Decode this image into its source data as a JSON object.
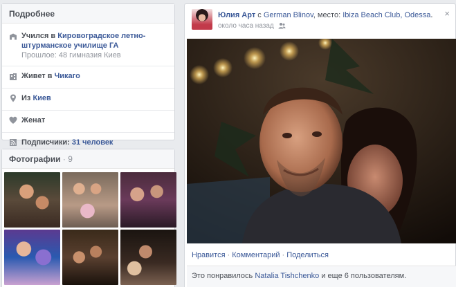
{
  "about": {
    "title": "Подробнее",
    "study": {
      "prefix": "Учился в ",
      "school_line1": "Кировоградское летно-",
      "school_line2": "штурманское училище ГА",
      "past": "Прошлое: 48 гимназия Киев"
    },
    "lives": {
      "prefix": "Живет в ",
      "city": "Чикаго"
    },
    "from": {
      "prefix": "Из ",
      "city": "Киев"
    },
    "relationship": "Женат",
    "followers": {
      "prefix": "Подписчики: ",
      "count": "31 человек"
    }
  },
  "photos": {
    "title": "Фотографии",
    "count": "9"
  },
  "post": {
    "author": "Юлия Арт",
    "with_word": " с ",
    "with_person": "German Blinov",
    "place_label": ", место: ",
    "place": "Ibiza Beach Club, Odessa",
    "period": ".",
    "time": "около часа назад",
    "close": "×",
    "actions": {
      "like": "Нравится",
      "comment": "Комментарий",
      "share": "Поделиться",
      "sep": "·"
    },
    "likes": {
      "prefix": "Это понравилось ",
      "person": "Natalia Tishchenko",
      "suffix": " и еще 6 пользователям."
    }
  },
  "icons": [
    "study-icon",
    "home-icon",
    "location-icon",
    "heart-icon",
    "rss-icon",
    "close-icon",
    "audience-icon"
  ],
  "colors": {
    "link": "#3b5998",
    "muted": "#90949c",
    "page_bg": "#e9ebee"
  }
}
